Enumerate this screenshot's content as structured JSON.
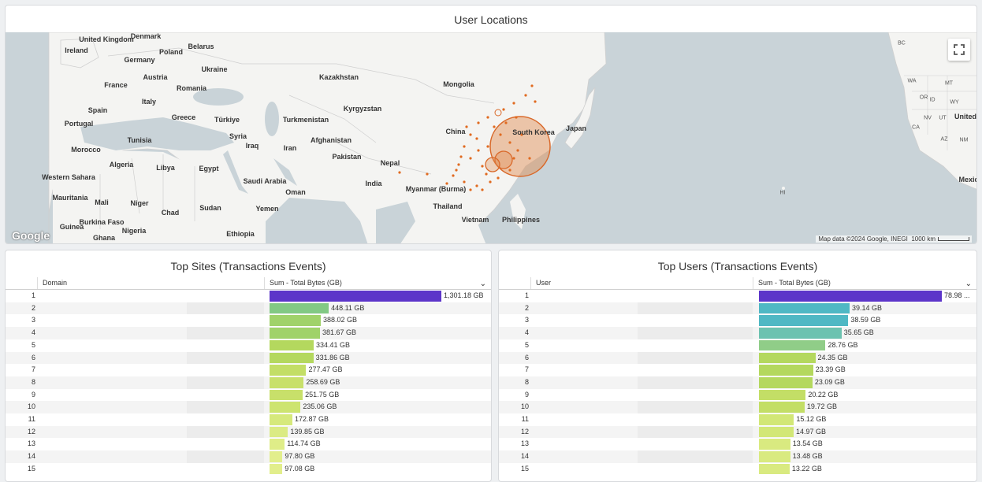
{
  "map_panel": {
    "title": "User Locations",
    "google_logo": "Google",
    "attribution": "Map data ©2024 Google, INEGI",
    "scale_label": "1000 km",
    "fullscreen_icon": "fullscreen-icon",
    "labels": [
      {
        "text": "United Kingdom",
        "small": false
      },
      {
        "text": "Denmark",
        "small": false
      },
      {
        "text": "Ireland",
        "small": false
      },
      {
        "text": "Belarus",
        "small": false
      },
      {
        "text": "Poland",
        "small": false
      },
      {
        "text": "Germany",
        "small": false
      },
      {
        "text": "Ukraine",
        "small": false
      },
      {
        "text": "Austria",
        "small": false
      },
      {
        "text": "France",
        "small": false
      },
      {
        "text": "Romania",
        "small": false
      },
      {
        "text": "Kazakhstan",
        "small": false
      },
      {
        "text": "Mongolia",
        "small": false
      },
      {
        "text": "Italy",
        "small": false
      },
      {
        "text": "Spain",
        "small": false
      },
      {
        "text": "Kyrgyzstan",
        "small": false
      },
      {
        "text": "Portugal",
        "small": false
      },
      {
        "text": "Greece",
        "small": false
      },
      {
        "text": "Türkiye",
        "small": false
      },
      {
        "text": "Turkmenistan",
        "small": false
      },
      {
        "text": "China",
        "small": false
      },
      {
        "text": "South Korea",
        "small": false
      },
      {
        "text": "Japan",
        "small": false
      },
      {
        "text": "Tunisia",
        "small": false
      },
      {
        "text": "Syria",
        "small": false
      },
      {
        "text": "Afghanistan",
        "small": false
      },
      {
        "text": "Morocco",
        "small": false
      },
      {
        "text": "Iraq",
        "small": false
      },
      {
        "text": "Iran",
        "small": false
      },
      {
        "text": "Pakistan",
        "small": false
      },
      {
        "text": "Algeria",
        "small": false
      },
      {
        "text": "Libya",
        "small": false
      },
      {
        "text": "Egypt",
        "small": false
      },
      {
        "text": "Nepal",
        "small": false
      },
      {
        "text": "Western Sahara",
        "small": false
      },
      {
        "text": "Saudi Arabia",
        "small": false
      },
      {
        "text": "India",
        "small": false
      },
      {
        "text": "Myanmar (Burma)",
        "small": false
      },
      {
        "text": "Oman",
        "small": false
      },
      {
        "text": "Mauritania",
        "small": false
      },
      {
        "text": "Mali",
        "small": false
      },
      {
        "text": "Niger",
        "small": false
      },
      {
        "text": "Sudan",
        "small": false
      },
      {
        "text": "Yemen",
        "small": false
      },
      {
        "text": "Thailand",
        "small": false
      },
      {
        "text": "Chad",
        "small": false
      },
      {
        "text": "Burkina Faso",
        "small": false
      },
      {
        "text": "Vietnam",
        "small": false
      },
      {
        "text": "Philippines",
        "small": false
      },
      {
        "text": "Guinea",
        "small": false
      },
      {
        "text": "Nigeria",
        "small": false
      },
      {
        "text": "Ghana",
        "small": false
      },
      {
        "text": "Ethiopia",
        "small": false
      },
      {
        "text": "BC",
        "small": true
      },
      {
        "text": "WA",
        "small": true
      },
      {
        "text": "MT",
        "small": true
      },
      {
        "text": "OR",
        "small": true
      },
      {
        "text": "ID",
        "small": true
      },
      {
        "text": "WY",
        "small": true
      },
      {
        "text": "NV",
        "small": true
      },
      {
        "text": "UT",
        "small": true
      },
      {
        "text": "CA",
        "small": true
      },
      {
        "text": "United",
        "small": false
      },
      {
        "text": "AZ",
        "small": true
      },
      {
        "text": "NM",
        "small": true
      },
      {
        "text": "HI",
        "small": true
      },
      {
        "text": "Mexic",
        "small": false
      }
    ]
  },
  "sites": {
    "title": "Top Sites (Transactions Events)",
    "col_domain": "Domain",
    "col_value": "Sum - Total Bytes (GB)",
    "rows": [
      {
        "rank": "1",
        "value": "1,301.18 GB",
        "v": 1301.18,
        "color": "#5c35c9"
      },
      {
        "rank": "2",
        "value": "448.11 GB",
        "v": 448.11,
        "color": "#82c984"
      },
      {
        "rank": "3",
        "value": "388.02 GB",
        "v": 388.02,
        "color": "#a0d26a"
      },
      {
        "rank": "4",
        "value": "381.67 GB",
        "v": 381.67,
        "color": "#a0d26a"
      },
      {
        "rank": "5",
        "value": "334.41 GB",
        "v": 334.41,
        "color": "#b4d85e"
      },
      {
        "rank": "6",
        "value": "331.86 GB",
        "v": 331.86,
        "color": "#b4d85e"
      },
      {
        "rank": "7",
        "value": "277.47 GB",
        "v": 277.47,
        "color": "#c3de66"
      },
      {
        "rank": "8",
        "value": "258.69 GB",
        "v": 258.69,
        "color": "#c8e06a"
      },
      {
        "rank": "9",
        "value": "251.75 GB",
        "v": 251.75,
        "color": "#c8e06a"
      },
      {
        "rank": "10",
        "value": "235.06 GB",
        "v": 235.06,
        "color": "#cde470"
      },
      {
        "rank": "11",
        "value": "172.87 GB",
        "v": 172.87,
        "color": "#d6e97c"
      },
      {
        "rank": "12",
        "value": "139.85 GB",
        "v": 139.85,
        "color": "#dbeb84"
      },
      {
        "rank": "13",
        "value": "114.74 GB",
        "v": 114.74,
        "color": "#dfed88"
      },
      {
        "rank": "14",
        "value": "97.80 GB",
        "v": 97.8,
        "color": "#e2ee8c"
      },
      {
        "rank": "15",
        "value": "97.08 GB",
        "v": 97.08,
        "color": "#e2ee8c"
      }
    ]
  },
  "users": {
    "title": "Top Users (Transactions Events)",
    "col_user": "User",
    "col_value": "Sum - Total Bytes (GB)",
    "rows": [
      {
        "rank": "1",
        "value": "78.98 ...",
        "v": 78.98,
        "color": "#5c35c9"
      },
      {
        "rank": "2",
        "value": "39.14 GB",
        "v": 39.14,
        "color": "#4fb8c4"
      },
      {
        "rank": "3",
        "value": "38.59 GB",
        "v": 38.59,
        "color": "#4fb8c4"
      },
      {
        "rank": "4",
        "value": "35.65 GB",
        "v": 35.65,
        "color": "#6cc2b0"
      },
      {
        "rank": "5",
        "value": "28.76 GB",
        "v": 28.76,
        "color": "#90cd88"
      },
      {
        "rank": "6",
        "value": "24.35 GB",
        "v": 24.35,
        "color": "#b4d85e"
      },
      {
        "rank": "7",
        "value": "23.39 GB",
        "v": 23.39,
        "color": "#b4d85e"
      },
      {
        "rank": "8",
        "value": "23.09 GB",
        "v": 23.09,
        "color": "#b4d85e"
      },
      {
        "rank": "9",
        "value": "20.22 GB",
        "v": 20.22,
        "color": "#c3de66"
      },
      {
        "rank": "10",
        "value": "19.72 GB",
        "v": 19.72,
        "color": "#c3de66"
      },
      {
        "rank": "11",
        "value": "15.12 GB",
        "v": 15.12,
        "color": "#d2e776"
      },
      {
        "rank": "12",
        "value": "14.97 GB",
        "v": 14.97,
        "color": "#d2e776"
      },
      {
        "rank": "13",
        "value": "13.54 GB",
        "v": 13.54,
        "color": "#d9ea80"
      },
      {
        "rank": "14",
        "value": "13.48 GB",
        "v": 13.48,
        "color": "#d9ea80"
      },
      {
        "rank": "15",
        "value": "13.22 GB",
        "v": 13.22,
        "color": "#d9ea80"
      }
    ]
  }
}
